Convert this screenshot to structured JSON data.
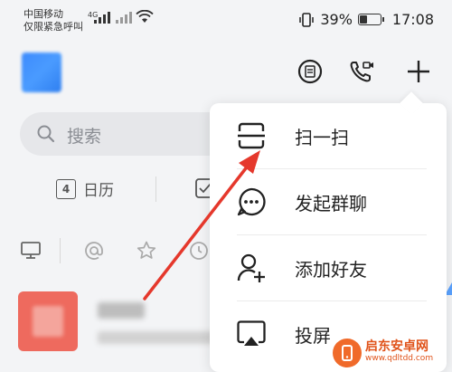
{
  "status_bar": {
    "carrier_line1": "中国移动",
    "carrier_line2": "仅限紧急呼叫",
    "network_type": "4G",
    "battery_percent": "39%",
    "battery_level": 0.39,
    "time": "17:08"
  },
  "header": {
    "icons": [
      "mini-program-icon",
      "phone-video-icon",
      "plus-icon"
    ]
  },
  "search": {
    "placeholder": "搜索"
  },
  "quick_actions": {
    "calendar_day": "4",
    "calendar_label": "日历"
  },
  "popover_menu": {
    "items": [
      {
        "label": "扫一扫",
        "icon": "scan-icon"
      },
      {
        "label": "发起群聊",
        "icon": "chat-bubble-icon"
      },
      {
        "label": "添加好友",
        "icon": "add-friend-icon"
      },
      {
        "label": "投屏",
        "icon": "screen-cast-icon"
      }
    ]
  },
  "annotation": {
    "arrow_color": "#e5382c"
  },
  "watermark": {
    "name": "启东安卓网",
    "url": "www.qdltdd.com",
    "color": "#e0531a"
  },
  "colors": {
    "accent_blue": "#3d8bfd",
    "avatar_red": "#ee6a5e",
    "background": "#f3f4f6"
  }
}
